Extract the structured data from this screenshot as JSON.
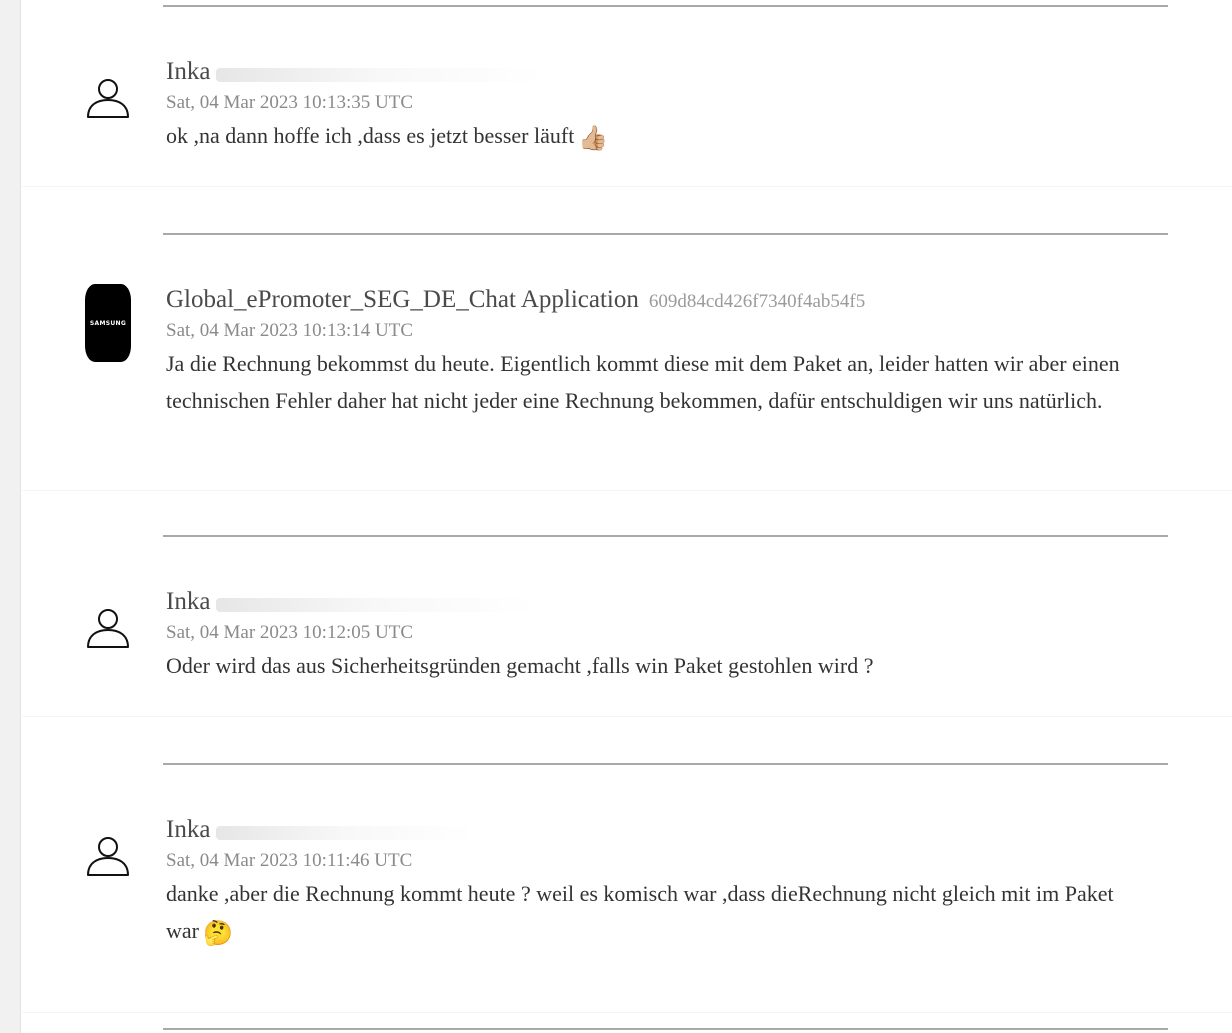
{
  "messages": [
    {
      "author": "Inka",
      "author_id": "",
      "avatar": "person-outline-icon",
      "timestamp": "Sat, 04 Mar 2023 10:13:35 UTC",
      "text": "ok ,na dann hoffe ich ,dass es jetzt besser läuft",
      "emoji": "👍🏼"
    },
    {
      "author": "Global_ePromoter_SEG_DE_Chat Application",
      "author_id": "609d84cd426f7340f4ab54f5",
      "avatar": "samsung-logo-avatar",
      "avatar_label": "SAMSUNG",
      "timestamp": "Sat, 04 Mar 2023 10:13:14 UTC",
      "text": "Ja die Rechnung bekommst du heute. Eigentlich kommt diese mit dem Paket an, leider hatten wir aber einen technischen Fehler daher hat nicht jeder eine Rechnung bekommen, dafür entschuldigen wir uns natürlich.",
      "emoji": ""
    },
    {
      "author": "Inka",
      "author_id": "",
      "avatar": "person-outline-icon",
      "timestamp": "Sat, 04 Mar 2023 10:12:05 UTC",
      "text": "Oder wird das aus Sicherheitsgründen gemacht ,falls win Paket gestohlen wird ?",
      "emoji": ""
    },
    {
      "author": "Inka",
      "author_id": "",
      "avatar": "person-outline-icon",
      "timestamp": "Sat, 04 Mar 2023 10:11:46 UTC",
      "text": "danke ,aber die Rechnung kommt heute ? weil es komisch war ,dass dieRechnung nicht gleich mit im Paket war",
      "emoji": "🤔"
    }
  ],
  "colors": {
    "divider": "#a9a9a9",
    "author": "#4a4a4a",
    "timestamp": "#8a8a8a",
    "body": "#333333"
  }
}
